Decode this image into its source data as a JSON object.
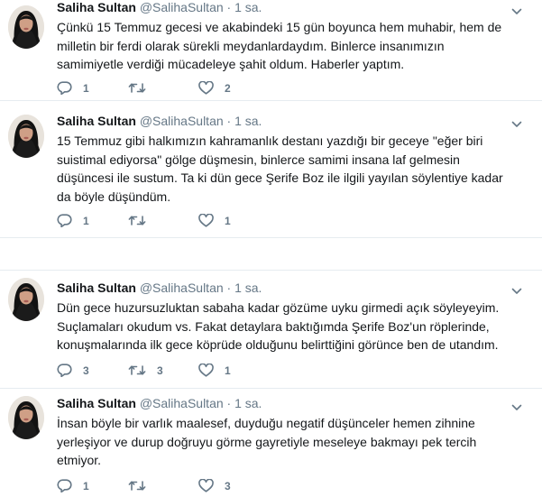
{
  "tweets": [
    {
      "name": "Saliha Sultan",
      "handle": "@SalihaSultan",
      "dot": "·",
      "time": "1 sa.",
      "lines": [
        "Çünkü 15 Temmuz gecesi ve akabindeki 15 gün boyunca hem muhabir, hem de",
        "milletin bir ferdi olarak sürekli meydanlardaydım. Binlerce insanımızın",
        "samimiyetle verdiği mücadeleye şahit oldum. Haberler yaptım."
      ],
      "replies": "1",
      "retweets": "",
      "likes": "2"
    },
    {
      "name": "Saliha Sultan",
      "handle": "@SalihaSultan",
      "dot": "·",
      "time": "1 sa.",
      "lines": [
        "15 Temmuz gibi halkımızın kahramanlık destanı yazdığı bir geceye \"eğer biri",
        "suistimal ediyorsa\" gölge düşmesin, binlerce samimi insana laf gelmesin",
        "düşüncesi ile sustum. Ta ki dün gece Şerife Boz ile ilgili yayılan söylentiye kadar",
        "da böyle düşündüm."
      ],
      "replies": "1",
      "retweets": "",
      "likes": "1"
    },
    {
      "name": "Saliha Sultan",
      "handle": "@SalihaSultan",
      "dot": "·",
      "time": "1 sa.",
      "lines": [
        "Dün gece huzursuzluktan sabaha kadar gözüme uyku girmedi açık söyleyeyim.",
        "Suçlamaları okudum vs. Fakat detaylara baktığımda Şerife Boz'un röplerinde,",
        "konuşmalarında ilk gece köprüde olduğunu belirttiğini görünce ben de utandım."
      ],
      "replies": "3",
      "retweets": "3",
      "likes": "1"
    },
    {
      "name": "Saliha Sultan",
      "handle": "@SalihaSultan",
      "dot": "·",
      "time": "1 sa.",
      "lines": [
        "İnsan böyle bir varlık maalesef, duyduğu negatif düşünceler hemen zihnine",
        "yerleşiyor ve durup doğruyu görme gayretiyle meseleye bakmayı pek tercih",
        "etmiyor."
      ],
      "replies": "1",
      "retweets": "",
      "likes": "3"
    }
  ],
  "colors": {
    "text": "#14171a",
    "muted": "#657786",
    "separator": "#e6ecf0"
  },
  "icons": [
    "reply-icon",
    "retweet-icon",
    "like-icon",
    "chevron-down-icon",
    "avatar"
  ]
}
